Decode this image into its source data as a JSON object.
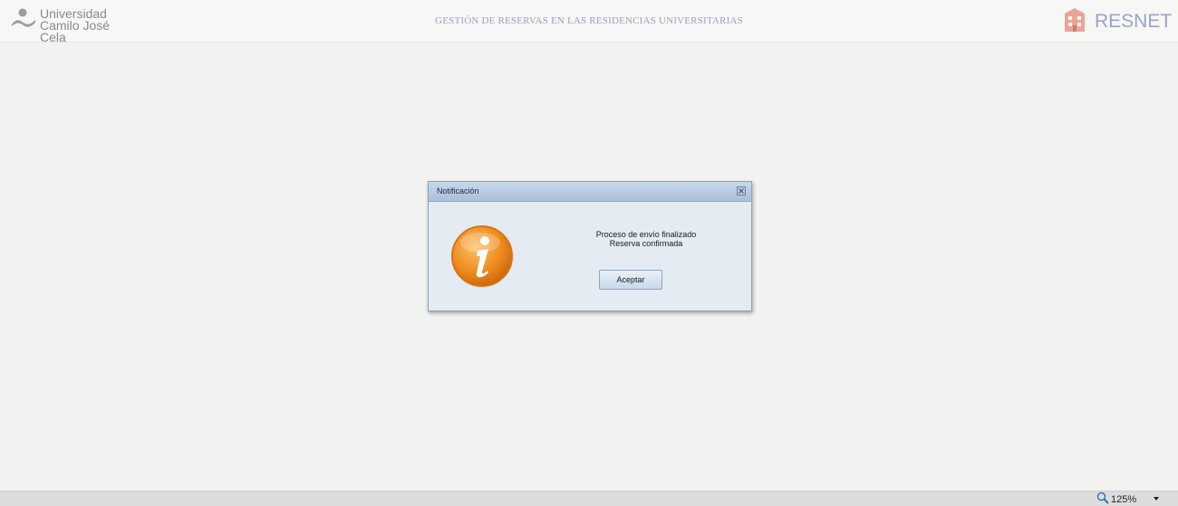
{
  "header": {
    "logo_line1": "Universidad",
    "logo_line2": "Camilo José Cela",
    "app_title": "GESTIÓN DE RESERVAS EN LAS RESIDENCIAS UNIVERSITARIAS",
    "brand_name": "RESNET"
  },
  "dialog": {
    "title": "Notificación",
    "icon": "info-icon",
    "message_line1": "Proceso de envío finalizado",
    "message_line2": "Reserva confirmada",
    "accept_label": "Aceptar"
  },
  "statusbar": {
    "zoom_level": "125%"
  },
  "colors": {
    "accent_title": "#9aa0c2",
    "dialog_bg": "#e4ebf3",
    "info_orange": "#e8861e"
  }
}
